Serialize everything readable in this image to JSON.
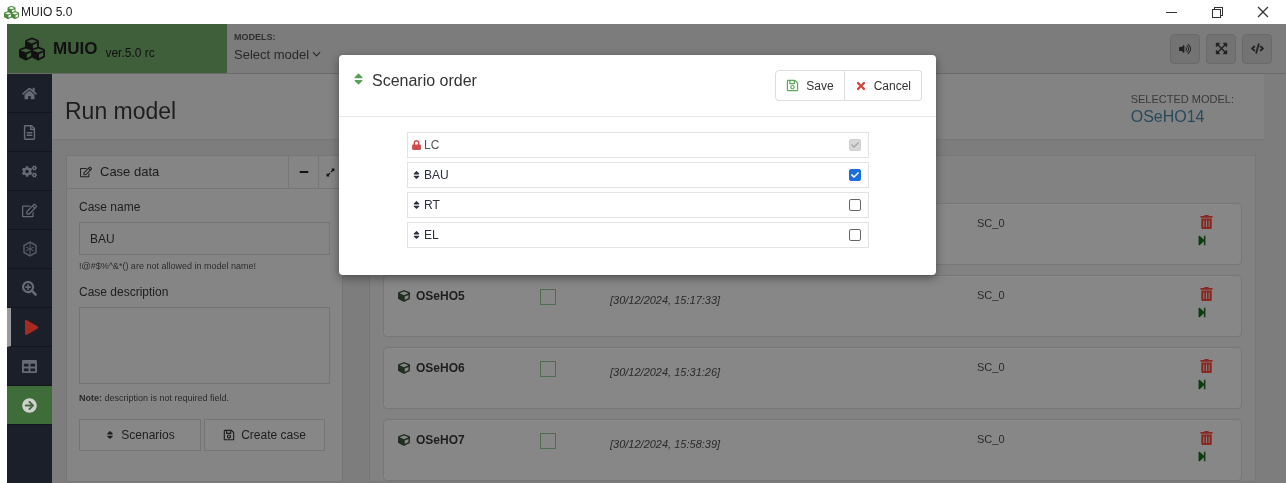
{
  "window": {
    "title": "MUIO 5.0"
  },
  "header": {
    "brand": "MUIO",
    "version": "ver.5.0 rc",
    "models_label": "MODELS:",
    "models_select": "Select model"
  },
  "sidebar": {
    "items": [
      {
        "selected": false,
        "kind": "nav"
      },
      {
        "selected": false,
        "kind": "nav"
      },
      {
        "selected": false,
        "kind": "nav"
      },
      {
        "selected": false,
        "kind": "nav"
      },
      {
        "selected": false,
        "kind": "nav"
      },
      {
        "selected": false,
        "kind": "nav"
      },
      {
        "selected": true,
        "kind": "nav"
      },
      {
        "selected": false,
        "kind": "nav"
      },
      {
        "selected": false,
        "kind": "action"
      }
    ]
  },
  "page": {
    "title": "Run model",
    "selected_model_label": "SELECTED MODEL:",
    "selected_model": "OSeHO14"
  },
  "case_panel": {
    "title": "Case data",
    "name_label": "Case name",
    "name_value": "BAU",
    "name_hint": "!@#$%^&*() are not allowed in model name!",
    "description_label": "Case description",
    "note": "**Note:** description is not required field.",
    "buttons": [
      "Scenarios",
      "Create case"
    ]
  },
  "cases": [
    {
      "scenario": "SC_0"
    },
    {
      "name": "OSeHO5",
      "date": "[30/12/2024, 15:17:33]",
      "scenario": "SC_0",
      "checked": false
    },
    {
      "name": "OSeHO6",
      "date": "[30/12/2024, 15:31:26]",
      "scenario": "SC_0",
      "checked": false
    },
    {
      "name": "OSeHO7",
      "date": "[30/12/2024, 15:58:39]",
      "scenario": "SC_0",
      "checked": false
    }
  ],
  "modal": {
    "title": "Scenario order",
    "buttons": [
      "Save",
      "Cancel"
    ],
    "scenarios": [
      {
        "name": "LC",
        "locked": true,
        "checked": true
      },
      {
        "name": "BAU",
        "locked": false,
        "checked": true
      },
      {
        "name": "RT",
        "locked": false,
        "checked": false
      },
      {
        "name": "EL",
        "locked": false,
        "checked": false
      }
    ]
  }
}
